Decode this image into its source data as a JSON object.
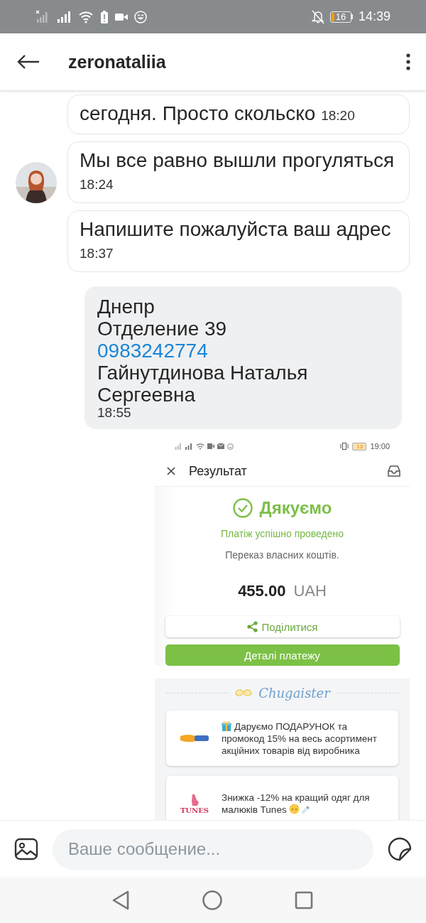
{
  "status_bar": {
    "battery": "16",
    "time": "14:39"
  },
  "header": {
    "title": "zeronataliia"
  },
  "messages": [
    {
      "kind": "incoming",
      "text": "сегодня. Просто скольско",
      "time": "18:20",
      "avatar": false
    },
    {
      "kind": "incoming",
      "text": "Мы все равно вышли прогуляться",
      "time": "18:24",
      "avatar": true
    },
    {
      "kind": "incoming",
      "text": "Напишите пожалуйста ваш адрес",
      "time": "18:37",
      "avatar": false
    },
    {
      "kind": "outgoing",
      "parts": [
        {
          "text": "Днепр",
          "link": false
        },
        {
          "text": "Отделение 39",
          "link": false
        },
        {
          "text": "0983242774",
          "link": true
        },
        {
          "text": "Гайнутдинова Наталья Сергеевна",
          "link": false
        }
      ],
      "time": "18:55"
    },
    {
      "kind": "screenshot",
      "status_bar": {
        "battery": "13",
        "time": "19:00"
      },
      "title": "Результат",
      "heading": "Дякуємо",
      "status": "Платіж успішно проведено",
      "description": "Переказ власних коштів.",
      "amount": "455.00",
      "currency": "UAH",
      "buttons": [
        {
          "label": "Поділитися",
          "kind": "outline"
        },
        {
          "label": "Деталі платежу",
          "kind": "filled"
        }
      ],
      "brand": "Chugaister",
      "offers": [
        {
          "kind": "club",
          "text": "Даруємо ПОДАРУНОК та промокод 15% на весь асортимент акційних товарів від виробника"
        },
        {
          "kind": "tunes",
          "logo_text": "TUNES",
          "text": "Знижка -12% на кращий одяг для малюків Tunes"
        }
      ]
    }
  ],
  "composer": {
    "placeholder": "Ваше сообщение..."
  }
}
